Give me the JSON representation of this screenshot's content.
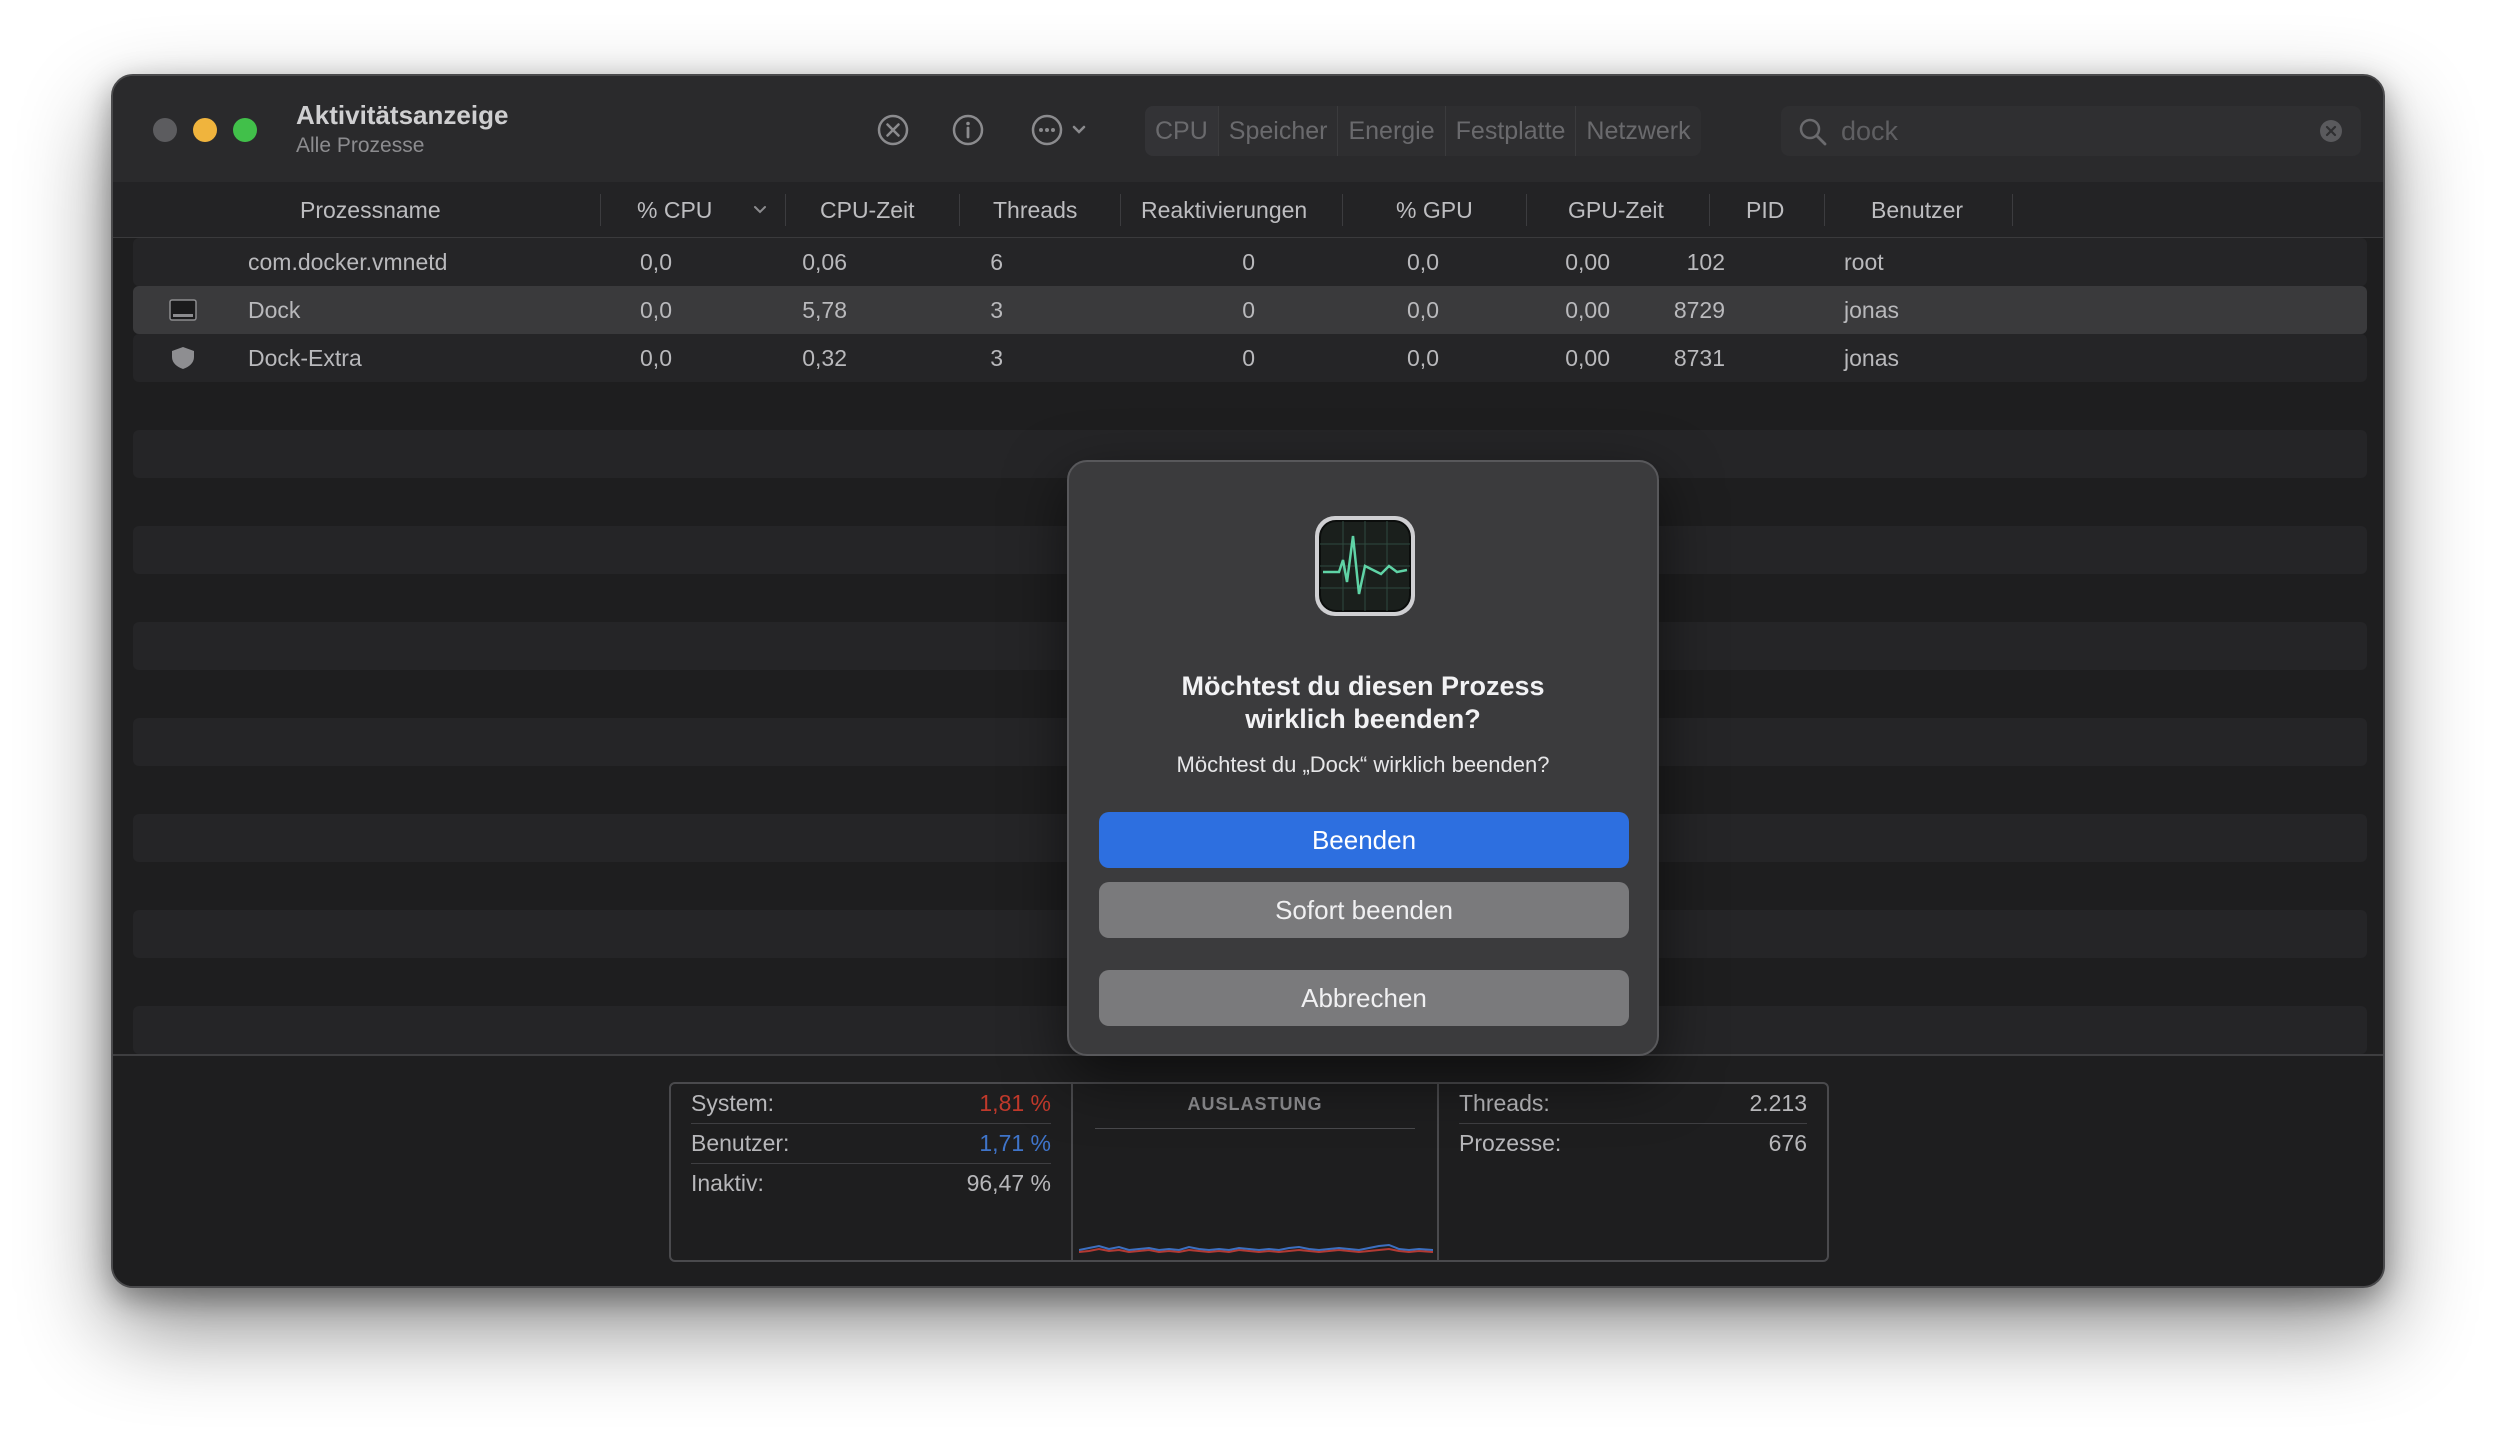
{
  "window": {
    "title": "Aktivitätsanzeige",
    "subtitle": "Alle Prozesse"
  },
  "toolbar": {
    "stop_icon": "stop-process-icon",
    "info_icon": "info-icon",
    "more_icon": "more-options-icon",
    "tabs": [
      "CPU",
      "Speicher",
      "Energie",
      "Festplatte",
      "Netzwerk"
    ],
    "selected_tab": "CPU"
  },
  "search": {
    "value": "dock",
    "icon": "search-icon",
    "clear_icon": "clear-icon"
  },
  "columns": [
    "Prozessname",
    "% CPU",
    "CPU-Zeit",
    "Threads",
    "Reaktivierungen",
    "% GPU",
    "GPU-Zeit",
    "PID",
    "Benutzer"
  ],
  "rows": [
    {
      "name": "com.docker.vmnetd",
      "cpu": "0,0",
      "cpu_time": "0,06",
      "threads": "6",
      "wakeups": "0",
      "gpu": "0,0",
      "gpu_time": "0,00",
      "pid": "102",
      "user": "root",
      "icon": "none",
      "selected": false
    },
    {
      "name": "Dock",
      "cpu": "0,0",
      "cpu_time": "5,78",
      "threads": "3",
      "wakeups": "0",
      "gpu": "0,0",
      "gpu_time": "0,00",
      "pid": "8729",
      "user": "jonas",
      "icon": "dock-app-icon",
      "selected": true
    },
    {
      "name": "Dock-Extra",
      "cpu": "0,0",
      "cpu_time": "0,32",
      "threads": "3",
      "wakeups": "0",
      "gpu": "0,0",
      "gpu_time": "0,00",
      "pid": "8731",
      "user": "jonas",
      "icon": "shield-icon",
      "selected": false
    }
  ],
  "footer": {
    "system_label": "System:",
    "system_value": "1,81 %",
    "user_label": "Benutzer:",
    "user_value": "1,71 %",
    "idle_label": "Inaktiv:",
    "idle_value": "96,47 %",
    "graph_title": "AUSLASTUNG",
    "threads_label": "Threads:",
    "threads_value": "2.213",
    "processes_label": "Prozesse:",
    "processes_value": "676"
  },
  "dialog": {
    "icon": "activity-monitor-icon",
    "title_line1": "Möchtest du diesen Prozess",
    "title_line2": "wirklich beenden?",
    "message": "Möchtest du „Dock“ wirklich beenden?",
    "primary_button": "Beenden",
    "force_button": "Sofort beenden",
    "cancel_button": "Abbrechen"
  },
  "colors": {
    "accent": "#2d6fe0",
    "system_red": "#c0392b",
    "user_blue": "#3f74c9"
  }
}
